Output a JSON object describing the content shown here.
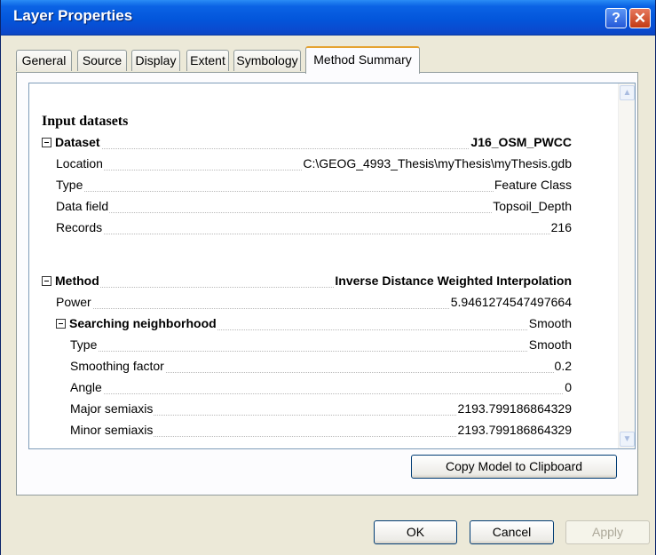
{
  "window": {
    "title": "Layer Properties"
  },
  "tabs": [
    {
      "label": "General"
    },
    {
      "label": "Source"
    },
    {
      "label": "Display"
    },
    {
      "label": "Extent"
    },
    {
      "label": "Symbology"
    },
    {
      "label": "Method Summary",
      "active": true
    }
  ],
  "summary": {
    "input_heading": "Input datasets",
    "dataset": {
      "label": "Dataset",
      "value": "J16_OSM_PWCC"
    },
    "location": {
      "label": "Location",
      "value": "C:\\GEOG_4993_Thesis\\myThesis\\myThesis.gdb"
    },
    "type": {
      "label": "Type",
      "value": "Feature Class"
    },
    "data_field": {
      "label": "Data field",
      "value": "Topsoil_Depth"
    },
    "records": {
      "label": "Records",
      "value": "216"
    },
    "method": {
      "label": "Method",
      "value": "Inverse Distance Weighted Interpolation"
    },
    "power": {
      "label": "Power",
      "value": "5.9461274547497664"
    },
    "searching": {
      "label": "Searching neighborhood",
      "value": "Smooth"
    },
    "search_type": {
      "label": "Type",
      "value": "Smooth"
    },
    "smoothing": {
      "label": "Smoothing factor",
      "value": "0.2"
    },
    "angle": {
      "label": "Angle",
      "value": "0"
    },
    "major": {
      "label": "Major semiaxis",
      "value": "2193.799186864329"
    },
    "minor": {
      "label": "Minor semiaxis",
      "value": "2193.799186864329"
    }
  },
  "buttons": {
    "copy_model": "Copy Model to Clipboard",
    "ok": "OK",
    "cancel": "Cancel",
    "apply": "Apply"
  },
  "icons": {
    "help": "?",
    "close": "✕",
    "scroll_up": "▲",
    "scroll_down": "▼"
  },
  "colors": {
    "title_bar": "#0356db",
    "dialog_bg": "#ece9d8",
    "active_tab_accent": "#e5a331"
  }
}
